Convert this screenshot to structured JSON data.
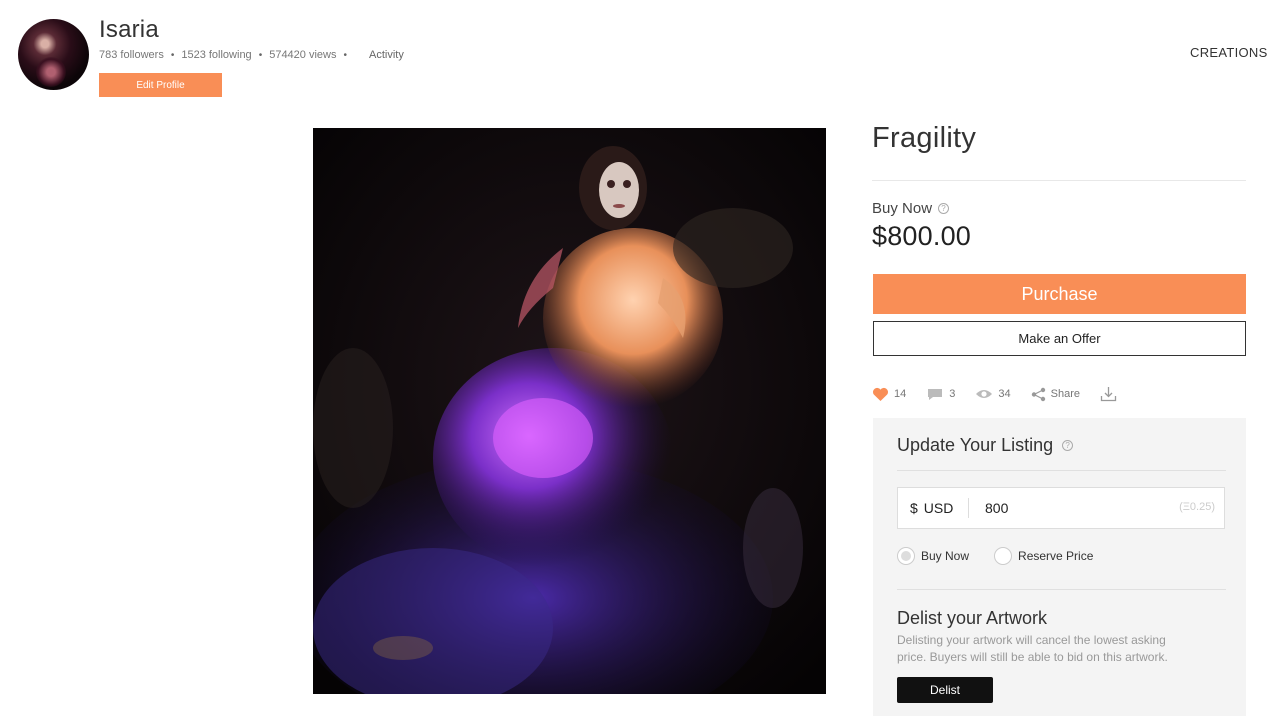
{
  "profile": {
    "username": "Isaria",
    "followers": "783 followers",
    "following": "1523 following",
    "views": "574420 views",
    "activity": "Activity",
    "edit_profile": "Edit Profile"
  },
  "nav": {
    "creations": "CREATIONS"
  },
  "artwork": {
    "title": "Fragility",
    "buy_now_label": "Buy Now",
    "price": "$800.00",
    "purchase_label": "Purchase",
    "offer_label": "Make an Offer"
  },
  "stats": {
    "likes": "14",
    "comments": "3",
    "views": "34",
    "share": "Share"
  },
  "listing": {
    "title": "Update Your Listing",
    "currency_symbol": "$",
    "currency": "USD",
    "price_value": "800",
    "eth_equiv": "(Ξ0.25)",
    "option_buy_now": "Buy Now",
    "option_reserve": "Reserve Price",
    "selected_option": "Buy Now"
  },
  "delist": {
    "title": "Delist your Artwork",
    "description": "Delisting your artwork will cancel the lowest asking price. Buyers will still be able to bid on this artwork.",
    "button": "Delist"
  },
  "colors": {
    "accent": "#f98e56",
    "like": "#f98e56",
    "dark_button": "#111111",
    "panel_bg": "#f4f4f4"
  }
}
